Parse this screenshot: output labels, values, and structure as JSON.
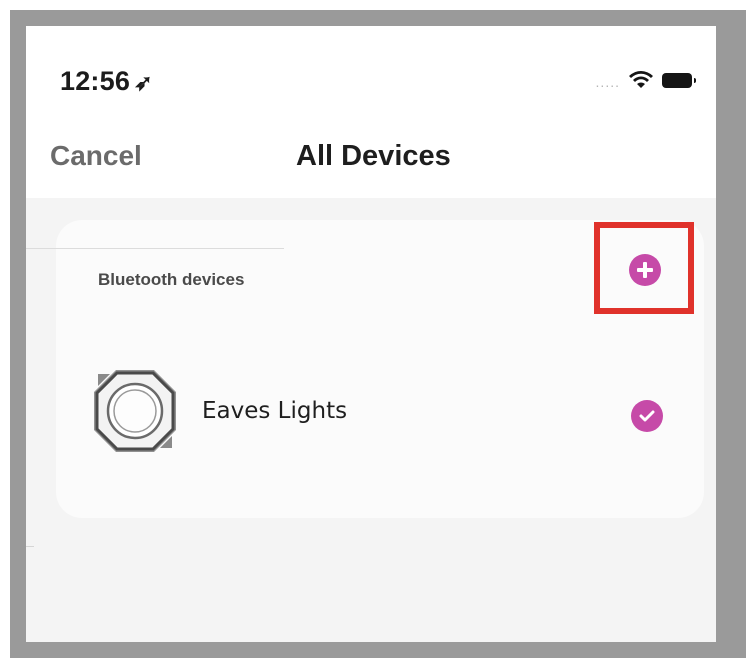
{
  "status_bar": {
    "time": "12:56",
    "location_icon": "location-arrow-icon",
    "signal_dots": ".....",
    "wifi_icon": "wifi-icon",
    "battery_icon": "battery-icon"
  },
  "nav": {
    "cancel_label": "Cancel",
    "title": "All Devices"
  },
  "section": {
    "label": "Bluetooth devices",
    "add_icon": "plus-circle-icon"
  },
  "devices": [
    {
      "name": "Eaves Lights",
      "icon": "eaves-light-icon",
      "selected": true,
      "check_icon": "checkmark-circle-icon"
    }
  ],
  "colors": {
    "accent": "#c64aa8",
    "highlight_box": "#e0322b",
    "frame": "#9a9a9a",
    "content_bg": "#f4f4f4"
  }
}
